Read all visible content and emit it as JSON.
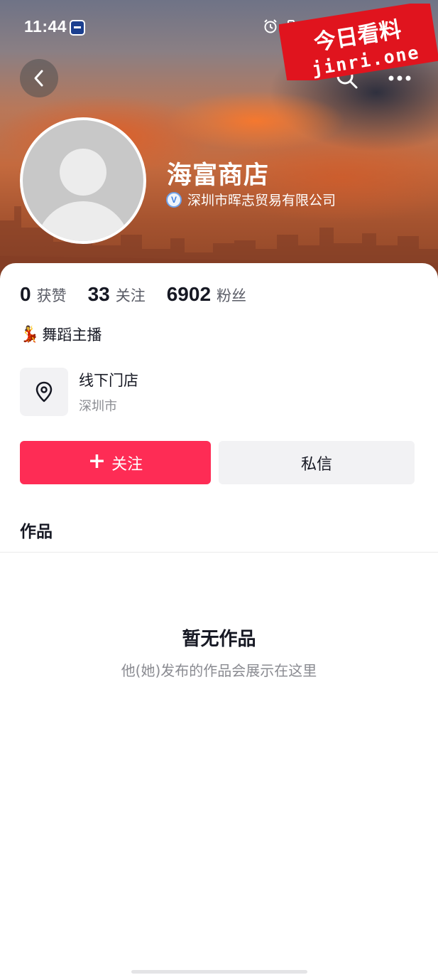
{
  "status_bar": {
    "time": "11:44"
  },
  "watermark": {
    "line1": "今日看料",
    "line2": "jinri.one"
  },
  "profile": {
    "name": "海富商店",
    "verification_badge": "V",
    "verified_company": "深圳市晖志贸易有限公司"
  },
  "stats": [
    {
      "value": "0",
      "label": "获赞"
    },
    {
      "value": "33",
      "label": "关注"
    },
    {
      "value": "6902",
      "label": "粉丝"
    }
  ],
  "bio": {
    "emoji": "💃",
    "text": "舞蹈主播"
  },
  "location": {
    "title": "线下门店",
    "subtitle": "深圳市"
  },
  "actions": {
    "follow_label": "关注",
    "message_label": "私信"
  },
  "tabs": {
    "works_label": "作品"
  },
  "empty_state": {
    "title": "暂无作品",
    "subtitle": "他(她)发布的作品会展示在这里"
  },
  "colors": {
    "follow_button": "#fe2c55",
    "watermark_red": "#e0141e"
  }
}
